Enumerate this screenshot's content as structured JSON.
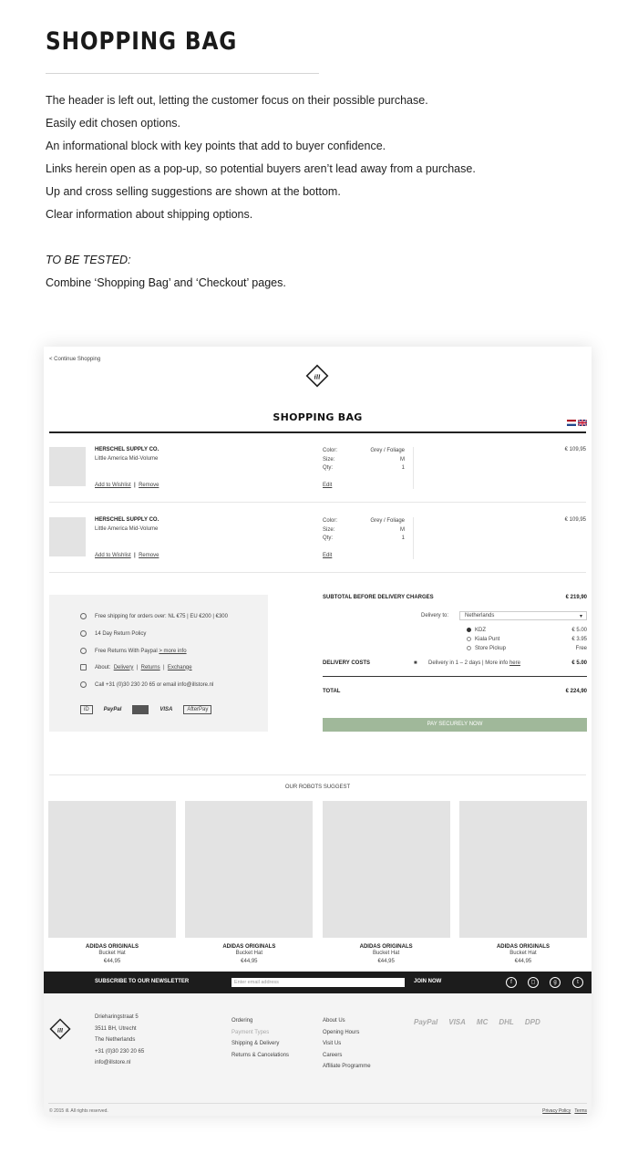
{
  "intro": {
    "title": "SHOPPING BAG",
    "points": [
      "The header is left out, letting the customer focus on their possible purchase.",
      "Easily edit chosen options.",
      "An informational block with key points that add to buyer confidence.",
      "Links herein open as a pop-up, so potential buyers aren’t lead away from a purchase.",
      "Up and cross selling suggestions are shown at the bottom.",
      "Clear information about shipping options."
    ],
    "to_be_tested_label": "TO BE TESTED:",
    "to_be_tested_text": "Combine ‘Shopping Bag’ and ‘Checkout’ pages."
  },
  "mockup": {
    "continue_link": "< Continue Shopping",
    "logo_text": "ill",
    "title": "SHOPPING BAG",
    "items": [
      {
        "brand": "HERSCHEL SUPPLY CO.",
        "product": "Little America Mid-Volume",
        "add_to_wishlist": "Add to Wishlist",
        "separator": "|",
        "remove": "Remove",
        "color_label": "Color:",
        "color_value": "Grey / Foliage",
        "size_label": "Size:",
        "size_value": "M",
        "qty_label": "Qty:",
        "qty_value": "1",
        "edit": "Edit",
        "price": "€ 109,95"
      },
      {
        "brand": "HERSCHEL SUPPLY CO.",
        "product": "Little America Mid-Volume",
        "add_to_wishlist": "Add to Wishlist",
        "separator": "|",
        "remove": "Remove",
        "color_label": "Color:",
        "color_value": "Grey / Foliage",
        "size_label": "Size:",
        "size_value": "M",
        "qty_label": "Qty:",
        "qty_value": "1",
        "edit": "Edit",
        "price": "€ 109,95"
      }
    ],
    "info": {
      "free_shipping": "Free shipping for orders over:   NL €75   |   EU €200   |   €300",
      "return_policy": "14 Day Return Policy",
      "free_returns": "Free Returns With Paypal",
      "more_info": "> more info",
      "about_label": "About:",
      "about_delivery": "Delivery",
      "about_returns": "Returns",
      "about_exchange": "Exchange",
      "sep": "|",
      "contact": "Call +31 (0)30 230 20 65 or email info@illstore.nl",
      "payment_logos": [
        "iD",
        "PayPal",
        "MasterCard",
        "VISA",
        "AfterPay"
      ]
    },
    "summary": {
      "subtotal_label": "SUBTOTAL BEFORE DELIVERY CHARGES",
      "subtotal_value": "€ 219,90",
      "delivery_to_label": "Delivery to:",
      "delivery_to_value": "Netherlands",
      "options": [
        {
          "name": "KDZ",
          "price": "€ 5.00"
        },
        {
          "name": "Kiala Punt",
          "price": "€ 3.95"
        },
        {
          "name": "Store Pickup",
          "price": "Free"
        }
      ],
      "delivery_costs_label": "DELIVERY COSTS",
      "delivery_note": "Delivery in 1 – 2 days  |  More info",
      "delivery_here": "here",
      "delivery_costs_value": "€ 5.00",
      "total_label": "TOTAL",
      "total_value": "€ 224,90",
      "pay_button": "PAY SECURELY NOW",
      "pay_button_color": "#a0b89a"
    },
    "suggest_title": "OUR ROBOTS SUGGEST",
    "suggestions": [
      {
        "brand": "ADIDAS ORIGINALS",
        "name": "Bucket Hat",
        "price": "€44,95"
      },
      {
        "brand": "ADIDAS ORIGINALS",
        "name": "Bucket Hat",
        "price": "€44,95"
      },
      {
        "brand": "ADIDAS ORIGINALS",
        "name": "Bucket Hat",
        "price": "€44,95"
      },
      {
        "brand": "ADIDAS ORIGINALS",
        "name": "Bucket Hat",
        "price": "€44,95"
      }
    ],
    "newsletter": {
      "label": "SUBSCRIBE TO OUR NEWSLETTER",
      "placeholder": "Enter email address",
      "join": "JOIN NOW",
      "social_icons": [
        "facebook-icon",
        "instagram-icon",
        "google-plus-icon",
        "twitter-icon"
      ]
    },
    "footer": {
      "address": [
        "Drieharingstraat 5",
        "3511 BH, Utrecht",
        "The Netherlands",
        "+31 (0)30 230 20 65",
        "info@illstore.nl"
      ],
      "col2": [
        "Ordering",
        "Payment Types",
        "Shipping & Delivery",
        "Returns & Cancelations"
      ],
      "col3": [
        "About Us",
        "Opening Hours",
        "Visit Us",
        "Careers",
        "Affiliate Programme"
      ],
      "partner_logos": [
        "PayPal",
        "VISA",
        "MC",
        "DHL",
        "DPD"
      ],
      "copyright": "© 2015 ill. All rights reserved.",
      "privacy": "Privacy Policy",
      "terms": "Terms"
    }
  }
}
